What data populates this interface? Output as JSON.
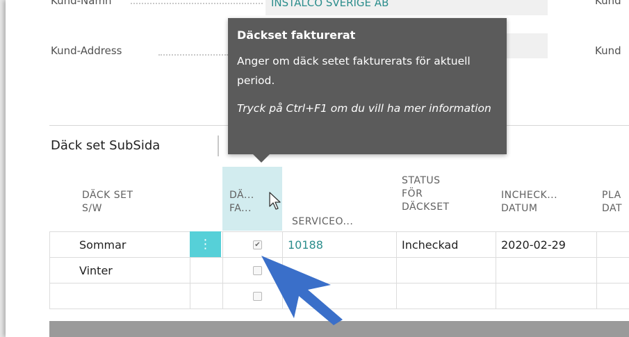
{
  "form": {
    "kund_namn_label": "Kund-Namn",
    "kund_namn_value": "INSTALCO SVERIGE AB",
    "kund_address_label": "Kund-Address",
    "right_label_1": "Kund",
    "right_label_2": "Kund"
  },
  "subpage": {
    "title": "Däck set SubSida"
  },
  "tooltip": {
    "title": "Däckset fakturerat",
    "body": "Anger om däck setet fakturerats för aktuell period.",
    "hint": "Tryck på Ctrl+F1 om du vill ha mer information"
  },
  "table": {
    "headers": {
      "dack_set": [
        "DÄCK SET",
        "S/W"
      ],
      "dack_fakturerat": [
        "DÄ...",
        "FA..."
      ],
      "serviceorder": [
        "SERVICEO..."
      ],
      "status": [
        "STATUS",
        "FÖR",
        "DÄCKSET"
      ],
      "incheckning": [
        "INCHECK...",
        "DATUM"
      ],
      "plan": [
        "PLA",
        "DAT"
      ]
    },
    "rows": [
      {
        "dack_set": "Sommar",
        "fakturerat": true,
        "serviceorder": "10188",
        "status": "Incheckad",
        "datum": "2020-02-29"
      },
      {
        "dack_set": "Vinter",
        "fakturerat": false,
        "serviceorder": "",
        "status": "",
        "datum": ""
      },
      {
        "dack_set": "",
        "fakturerat": false,
        "serviceorder": "",
        "status": "",
        "datum": ""
      }
    ],
    "row_menu_icon": "⋮"
  },
  "colors": {
    "accent": "#2b8d8c",
    "menu_button": "#56d0d8",
    "tooltip_bg": "#5b5b5b",
    "column_highlight": "#d2ecef",
    "annotation_arrow": "#3a6fc9"
  },
  "icons": {
    "cursor": "mouse-pointer-icon",
    "annotation": "blue-arrow-icon"
  }
}
